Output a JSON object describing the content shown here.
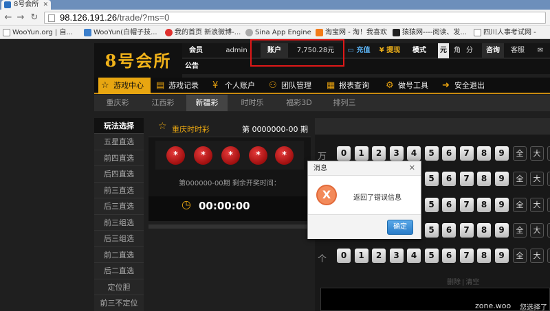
{
  "browser": {
    "tab_title": "8号会所",
    "url_host": "98.126.191.26",
    "url_path": "/trade/?ms=0",
    "bookmarks": [
      "WooYun.org | 自...",
      "WooYun(白帽子技...",
      "我的首页 新浪微博-...",
      "Sina App Engine",
      "淘宝网 - 淘！我喜欢",
      "猿猿网----阅读、发...",
      "四川人事考试网 -"
    ]
  },
  "header": {
    "logo": "8号会所",
    "member_label": "会员",
    "member_value": "admin",
    "account_label": "账户",
    "balance": "7,750.28元",
    "recharge": "充值",
    "withdraw": "提现",
    "mode_label": "模式",
    "mode_opts": [
      "元",
      "角",
      "分"
    ],
    "consult": "咨询",
    "service": "客服",
    "notice_label": "公告"
  },
  "nav": {
    "items": [
      "游戏中心",
      "游戏记录",
      "个人账户",
      "团队管理",
      "报表查询",
      "做号工具",
      "安全退出"
    ]
  },
  "subnav": {
    "items": [
      "重庆彩",
      "江西彩",
      "新疆彩",
      "时时乐",
      "福彩3D",
      "排列三"
    ]
  },
  "left": {
    "title": "玩法选择",
    "items": [
      "五星直选",
      "前四直选",
      "后四直选",
      "前三直选",
      "后三直选",
      "前三组选",
      "后三组选",
      "前二直选",
      "后二直选",
      "定位胆",
      "前三不定位"
    ]
  },
  "center": {
    "game_name": "重庆时时彩",
    "issue": "第 0000000-00 期",
    "balls": [
      "*",
      "*",
      "*",
      "*",
      "*"
    ],
    "countdown_label": "第000000-00期 剩余开奖时间：",
    "time": "00:00:00"
  },
  "picker": {
    "row_labels": [
      "万",
      "千",
      "百",
      "十",
      "个"
    ],
    "digits": [
      "0",
      "1",
      "2",
      "3",
      "4",
      "5",
      "6",
      "7",
      "8",
      "9"
    ],
    "quick": [
      "全",
      "大",
      "小"
    ],
    "delete": "删除",
    "clear": "清空"
  },
  "dialog": {
    "title": "消息",
    "message": "返回了错误信息",
    "ok": "确定"
  },
  "watermark": {
    "text": "zone.woo",
    "text2": "您选择了"
  }
}
